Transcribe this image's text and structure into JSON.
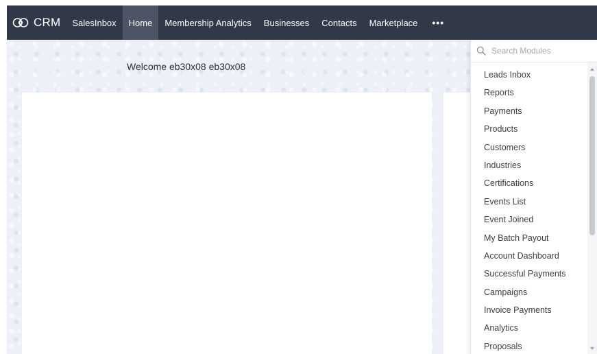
{
  "app": {
    "brand": "CRM"
  },
  "nav": {
    "items": [
      {
        "label": "SalesInbox"
      },
      {
        "label": "Home"
      },
      {
        "label": "Membership Analytics"
      },
      {
        "label": "Businesses"
      },
      {
        "label": "Contacts"
      },
      {
        "label": "Marketplace"
      }
    ],
    "active": "Home",
    "more_label": "•••"
  },
  "home": {
    "welcome": "Welcome eb30x08 eb30x08"
  },
  "modules": {
    "search_placeholder": "Search Modules",
    "items": [
      {
        "label": "Leads Inbox"
      },
      {
        "label": "Reports"
      },
      {
        "label": "Payments"
      },
      {
        "label": "Products"
      },
      {
        "label": "Customers"
      },
      {
        "label": "Industries"
      },
      {
        "label": "Certifications"
      },
      {
        "label": "Events List"
      },
      {
        "label": "Event Joined"
      },
      {
        "label": "My Batch Payout"
      },
      {
        "label": "Account Dashboard"
      },
      {
        "label": "Successful Payments"
      },
      {
        "label": "Campaigns"
      },
      {
        "label": "Invoice Payments"
      },
      {
        "label": "Analytics"
      },
      {
        "label": "Proposals"
      }
    ]
  },
  "colors": {
    "topbar": "#313948",
    "active_tab": "#4c5466",
    "background": "#edf1f7"
  },
  "icons": {
    "brand": "crm-logo-icon",
    "search": "search-icon"
  }
}
